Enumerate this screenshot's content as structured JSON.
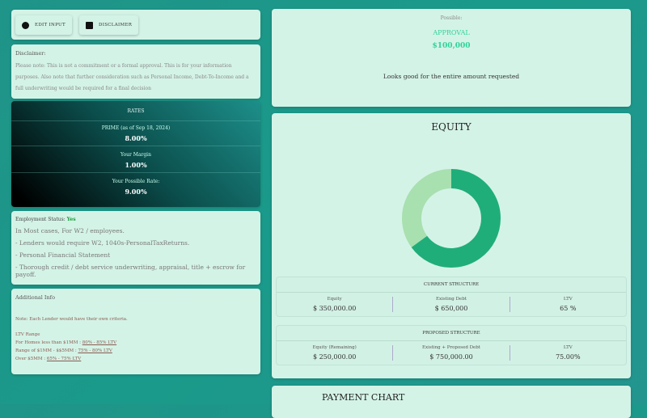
{
  "toolbar": {
    "edit_input": "EDIT INPUT",
    "disclaimer": "DISCLAIMER"
  },
  "disclaimer": {
    "title": "Disclaimer:",
    "text": "Please note: This is not a commitment or a formal approval. This is for your information purposes. Also note that further consideration such as Personal Income, Debt-To-Income and a full underwriting would be required for a final decision"
  },
  "rates": {
    "title": "RATES",
    "rows": [
      {
        "label": "PRIME (as of Sep 18, 2024)",
        "value": "8.00%"
      },
      {
        "label": "Your Margin",
        "value": "1.00%"
      },
      {
        "label": "Your Possible Rate:",
        "value": "9.00%"
      }
    ]
  },
  "employment": {
    "label": "Employment Status:",
    "status": "Yes",
    "lines": [
      "In Most cases, For W2 / employees.",
      "- Lenders would require W2, 1040s-PersonalTaxReturns.",
      "- Personal Financial Statement",
      "- Thorough credit / debt service underwriting, appraisal, title + escrow for payoff."
    ]
  },
  "additional": {
    "title": "Additional Info",
    "note": "Note: Each Lender would have their own criteria.",
    "ltv_title": "LTV Range",
    "ranges": [
      {
        "label": "For Homes less than $1MM :",
        "value": "80% - 85% LTV"
      },
      {
        "label": "Range of $1MM - $$5MM :",
        "value": "75% - 80% LTV"
      },
      {
        "label": "Over $5MM :",
        "value": "65% - 75% LTV"
      }
    ]
  },
  "approval": {
    "possible": "Possible:",
    "status": "APPROVAL",
    "amount": "$100,000",
    "message": "Looks good for the entire amount requested"
  },
  "equity": {
    "title": "EQUITY",
    "chart_data": {
      "type": "pie",
      "donut": true,
      "categories": [
        "Existing Debt",
        "Equity"
      ],
      "values": [
        650000,
        350000
      ],
      "colors": [
        "#1fae7a",
        "#a8e0b0"
      ]
    }
  },
  "current": {
    "title": "CURRENT STRUCTURE",
    "cols": [
      {
        "label": "Equity",
        "value": "$ 350,000.00"
      },
      {
        "label": "Existing Debt",
        "value": "$ 650,000"
      },
      {
        "label": "LTV",
        "value": "65 %"
      }
    ]
  },
  "proposed": {
    "title": "PROPOSED STRUCTURE",
    "cols": [
      {
        "label": "Equity (Remaining)",
        "value": "$ 250,000.00"
      },
      {
        "label": "Existing + Proposed Debt",
        "value": "$ 750,000.00"
      },
      {
        "label": "LTV",
        "value": "75.00%"
      }
    ]
  },
  "payment": {
    "title": "PAYMENT CHART"
  }
}
